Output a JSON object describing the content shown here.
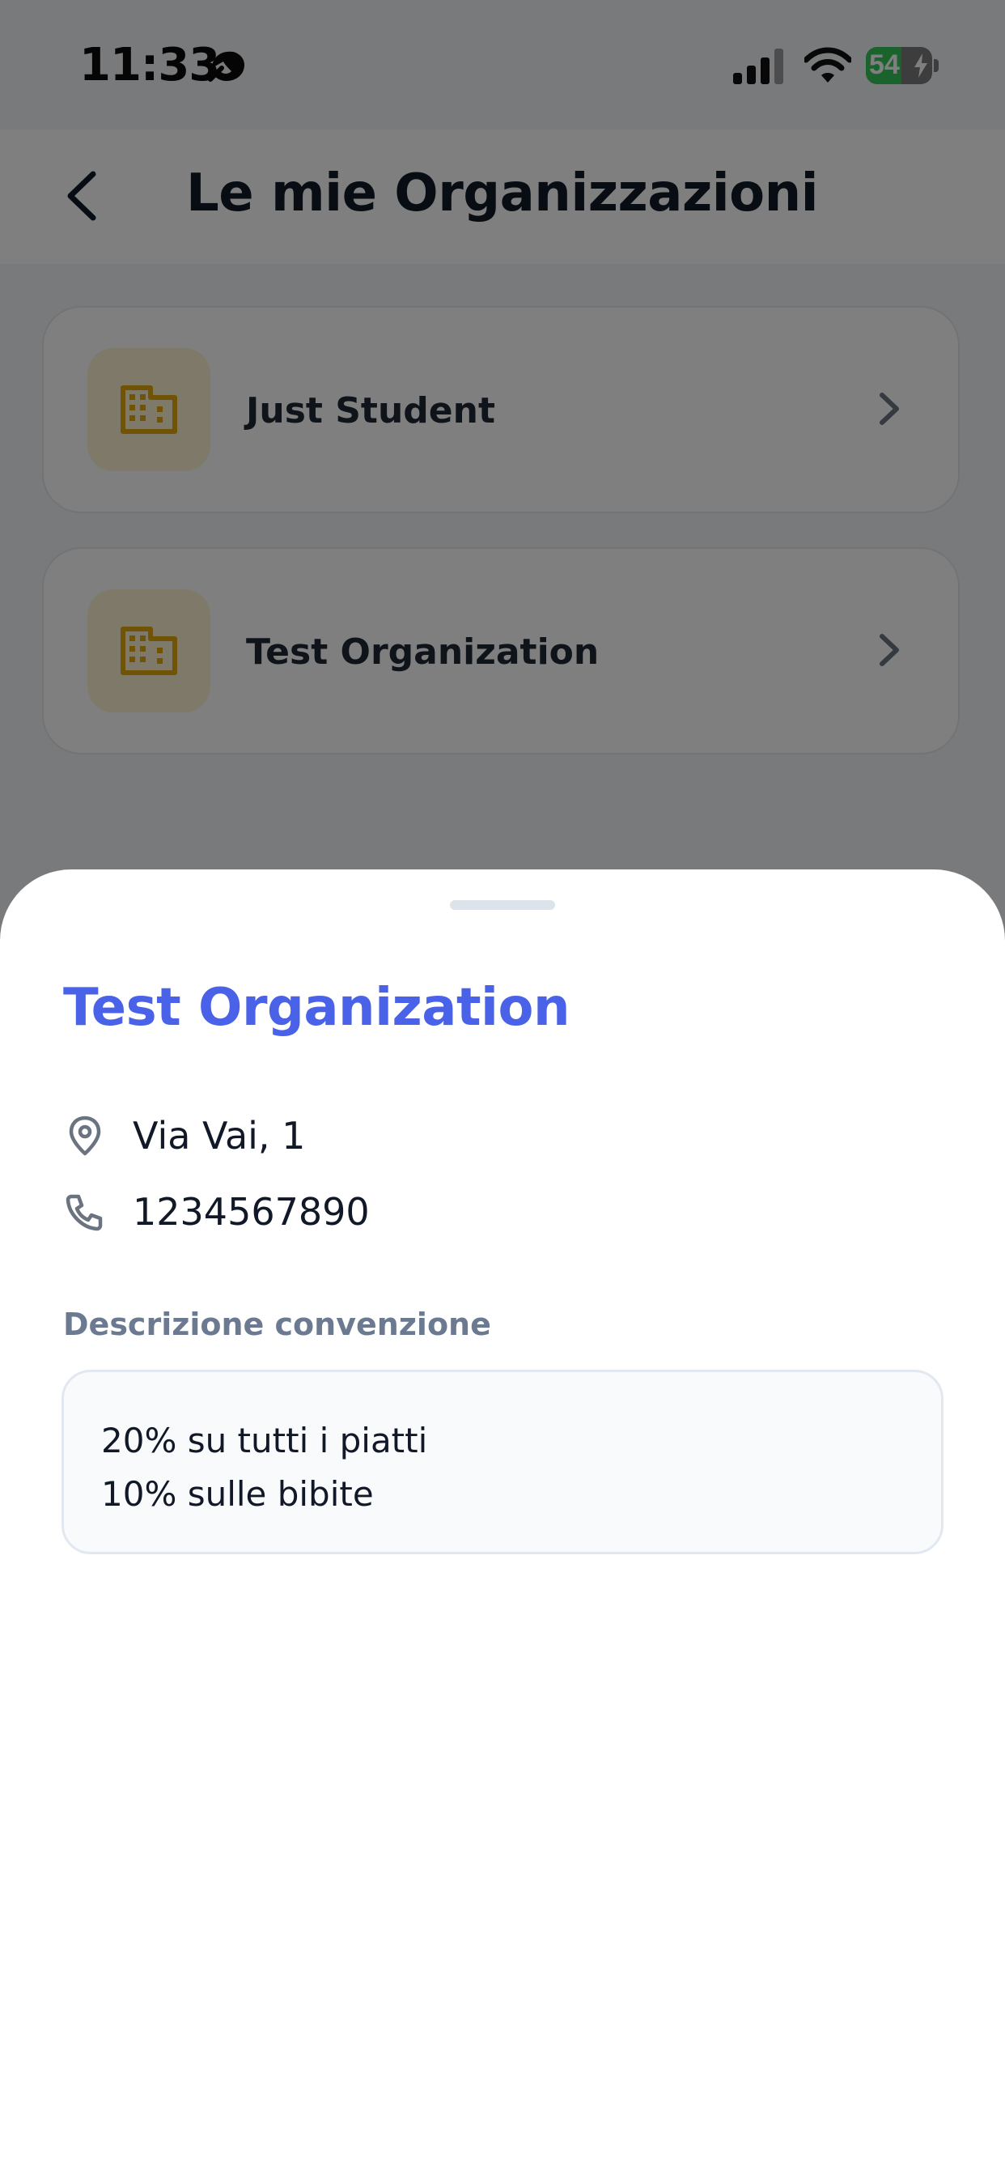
{
  "status_bar": {
    "time": "11:33",
    "battery_level": "54",
    "battery_fraction": 0.54
  },
  "header": {
    "title": "Le mie Organizzazioni"
  },
  "organizations": [
    {
      "name": "Just Student"
    },
    {
      "name": "Test Organization"
    }
  ],
  "sheet": {
    "title": "Test Organization",
    "address": "Via Vai, 1",
    "phone": "1234567890",
    "description_label": "Descrizione convenzione",
    "description_lines": [
      "20% su tutti i piatti",
      "10% sulle bibite"
    ]
  },
  "colors": {
    "accent": "#4a62e8",
    "org_icon": "#e3a60a",
    "org_icon_bg": "#fdf3d3",
    "battery": "#34c759"
  },
  "icons": {
    "back": "chevron-left-icon",
    "org": "building-icon",
    "row_arrow": "chevron-right-icon",
    "address": "map-pin-icon",
    "phone": "phone-icon"
  }
}
